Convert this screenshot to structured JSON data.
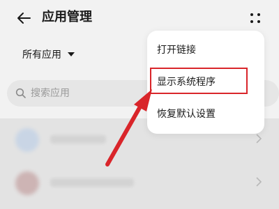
{
  "header": {
    "title": "应用管理",
    "back_icon": "back-arrow-icon",
    "more_icon": "more-dots-icon"
  },
  "filter": {
    "label": "所有应用",
    "caret_icon": "caret-down-icon"
  },
  "search": {
    "placeholder": "搜索应用",
    "icon": "search-icon"
  },
  "menu": {
    "items": [
      {
        "label": "打开链接"
      },
      {
        "label": "显示系统程序"
      },
      {
        "label": "恢复默认设置"
      }
    ]
  },
  "annotation": {
    "highlight_color": "#d9252a",
    "highlighted_item": "显示系统程序"
  },
  "app_list": {
    "rows": [
      {
        "icon_color": "#c9dcf5"
      },
      {
        "icon_color": "#cfa9a9"
      }
    ]
  }
}
